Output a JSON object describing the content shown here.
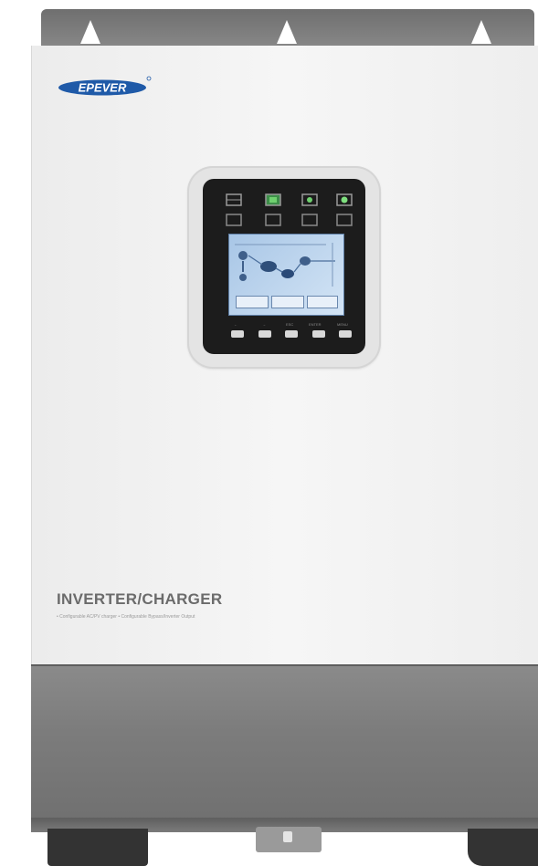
{
  "brand": {
    "logo_text": "EPEVER"
  },
  "product": {
    "title": "INVERTER/CHARGER",
    "subtitle": "• Configurable AC/PV charger  • Configurable Bypass/Inverter Output"
  },
  "display": {
    "button_labels": [
      "←",
      "→",
      "ESC",
      "ENTER",
      "MENU"
    ]
  },
  "colors": {
    "panel": "#f2f2f2",
    "housing": "#7d7d7d",
    "lcd": "#b9d2ec",
    "brand_blue": "#1f5aa8"
  }
}
